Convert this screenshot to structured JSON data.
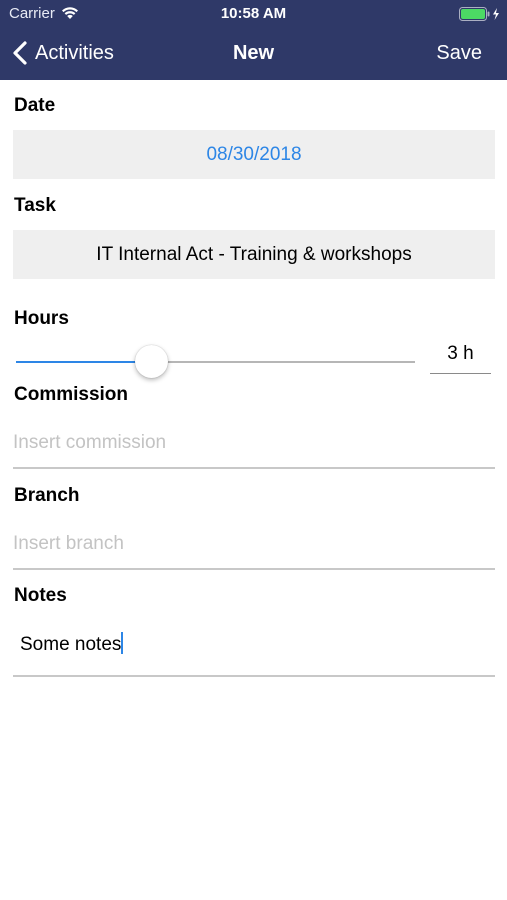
{
  "status_bar": {
    "carrier": "Carrier",
    "time": "10:58 AM",
    "wifi_icon": "wifi-icon",
    "battery_icon": "battery-charging-icon"
  },
  "nav": {
    "back_label": "Activities",
    "title": "New",
    "save_label": "Save",
    "back_icon": "chevron-left-icon"
  },
  "colors": {
    "header": "#2f3968",
    "accent": "#2d86e6",
    "field_bg": "#efefef"
  },
  "form": {
    "date": {
      "label": "Date",
      "value": "08/30/2018"
    },
    "task": {
      "label": "Task",
      "value": "IT Internal Act - Training & workshops"
    },
    "hours": {
      "label": "Hours",
      "value_text": "3 h",
      "slider_fraction": 0.34
    },
    "commission": {
      "label": "Commission",
      "placeholder": "Insert commission",
      "value": ""
    },
    "branch": {
      "label": "Branch",
      "placeholder": "Insert branch",
      "value": ""
    },
    "notes": {
      "label": "Notes",
      "value": "Some notes"
    }
  }
}
